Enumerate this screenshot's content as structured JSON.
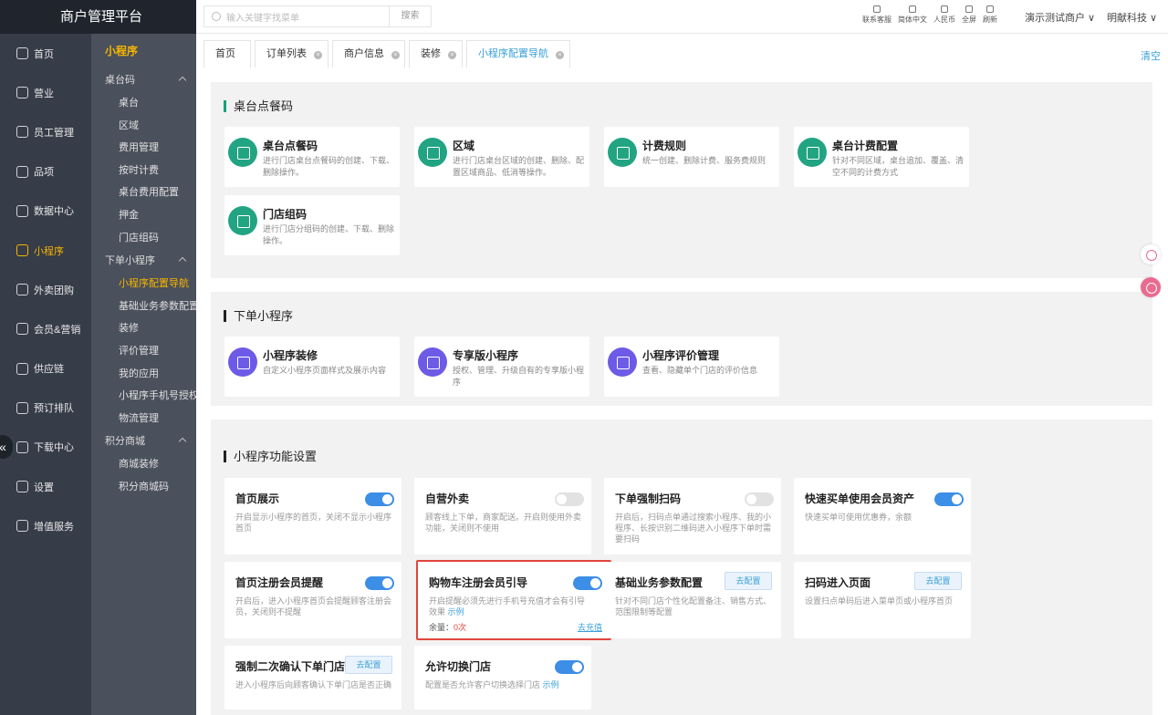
{
  "brand": "商户管理平台",
  "nav_main": [
    {
      "label": "首页",
      "icon": "home-icon"
    },
    {
      "label": "营业",
      "icon": "cash-icon"
    },
    {
      "label": "员工管理",
      "icon": "users-icon"
    },
    {
      "label": "品项",
      "icon": "bag-icon"
    },
    {
      "label": "数据中心",
      "icon": "share-icon"
    },
    {
      "label": "小程序",
      "icon": "phone-icon",
      "active": true
    },
    {
      "label": "外卖团购",
      "icon": "bike-icon"
    },
    {
      "label": "会员&营销",
      "icon": "user-icon"
    },
    {
      "label": "供应链",
      "icon": "truck-icon"
    },
    {
      "label": "预订排队",
      "icon": "clock-icon"
    },
    {
      "label": "下载中心",
      "icon": "download-icon"
    },
    {
      "label": "设置",
      "icon": "gear-icon"
    },
    {
      "label": "增值服务",
      "icon": "service-icon"
    }
  ],
  "nav_sub": {
    "title": "小程序",
    "groups": [
      {
        "label": "桌台码",
        "items": [
          "桌台",
          "区域",
          "费用管理",
          "按时计费",
          "桌台费用配置",
          "押金",
          "门店组码"
        ]
      },
      {
        "label": "下单小程序",
        "items": [
          "小程序配置导航",
          "基础业务参数配置",
          "装修",
          "评价管理",
          "我的应用",
          "小程序手机号授权",
          "物流管理"
        ]
      },
      {
        "label": "积分商城",
        "items": [
          "商城装修",
          "积分商城码"
        ]
      }
    ],
    "active_item": "小程序配置导航"
  },
  "topbar": {
    "search_placeholder": "输入关键字找菜单",
    "search_button": "搜索",
    "tools": [
      "联系客服",
      "简体中文",
      "人民币",
      "全屏",
      "刷新"
    ],
    "merchant": "演示测试商户 ∨",
    "company": "明献科技 ∨"
  },
  "tabs": {
    "items": [
      {
        "label": "首页",
        "closable": false
      },
      {
        "label": "订单列表",
        "closable": true
      },
      {
        "label": "商户信息",
        "closable": true
      },
      {
        "label": "装修",
        "closable": true
      },
      {
        "label": "小程序配置导航",
        "closable": true,
        "active": true
      }
    ],
    "clear": "清空"
  },
  "sections": {
    "table_code": {
      "title": "桌台点餐码",
      "cards": [
        {
          "title": "桌台点餐码",
          "desc": "进行门店桌台点餐码的创建、下载、删除操作。"
        },
        {
          "title": "区域",
          "desc": "进行门店桌台区域的创建、删除、配置区域商品、低消等操作。"
        },
        {
          "title": "计费规则",
          "desc": "统一创建、删除计费、服务费规则"
        },
        {
          "title": "桌台计费配置",
          "desc": "针对不同区域，桌台追加、覆盖、清空不同的计费方式"
        },
        {
          "title": "门店组码",
          "desc": "进行门店分组码的创建、下载、删除操作。"
        }
      ]
    },
    "order_app": {
      "title": "下单小程序",
      "cards": [
        {
          "title": "小程序装修",
          "desc": "自定义小程序页面样式及展示内容"
        },
        {
          "title": "专享版小程序",
          "desc": "授权、管理、升级自有的专享版小程序"
        },
        {
          "title": "小程序评价管理",
          "desc": "查看、隐藏单个门店的评价信息"
        }
      ]
    },
    "features": {
      "title": "小程序功能设置",
      "cards": [
        {
          "title": "首页展示",
          "desc": "开启显示小程序的首页，关闭不显示小程序首页",
          "control": "toggle-on"
        },
        {
          "title": "自营外卖",
          "desc": "顾客线上下单，商家配送。开启则使用外卖功能，关闭则不使用",
          "control": "toggle-off"
        },
        {
          "title": "下单强制扫码",
          "desc": "开启后，扫码点单通过搜索小程序、我的小程序、长按识别二维码进入小程序下单时需要扫码",
          "control": "toggle-off"
        },
        {
          "title": "快速买单使用会员资产",
          "desc": "快速买单可使用优惠券，余额",
          "control": "toggle-on"
        },
        {
          "title": "首页注册会员提醒",
          "desc": "开启后，进入小程序首页会提醒顾客注册会员，关闭则不提醒",
          "control": "toggle-on"
        },
        {
          "title": "购物车注册会员引导",
          "desc": "开启提醒必须先进行手机号充值才会有引导效果",
          "link": "示例",
          "remain_label": "余量：",
          "remain_value": "0次",
          "recharge": "去充值",
          "control": "toggle-on"
        },
        {
          "title": "基础业务参数配置",
          "desc": "针对不同门店个性化配置备注、销售方式、范围限制等配置",
          "control": "button",
          "button": "去配置"
        },
        {
          "title": "扫码进入页面",
          "desc": "设置扫点单码后进入菜单页或小程序首页",
          "control": "button",
          "button": "去配置"
        },
        {
          "title": "强制二次确认下单门店",
          "desc": "进入小程序后向顾客确认下单门店是否正确",
          "control": "button",
          "button": "去配置"
        },
        {
          "title": "允许切换门店",
          "desc": "配置是否允许客户切换选择门店",
          "link": "示例",
          "control": "toggle-on"
        }
      ]
    }
  },
  "colors": {
    "accent": "#3aa0d8",
    "brand_dark": "#20242d",
    "active": "#f7b500",
    "green": "#22a483",
    "purple": "#6d5ae6",
    "toggle": "#3c8ee6",
    "highlight": "#e0453c"
  }
}
